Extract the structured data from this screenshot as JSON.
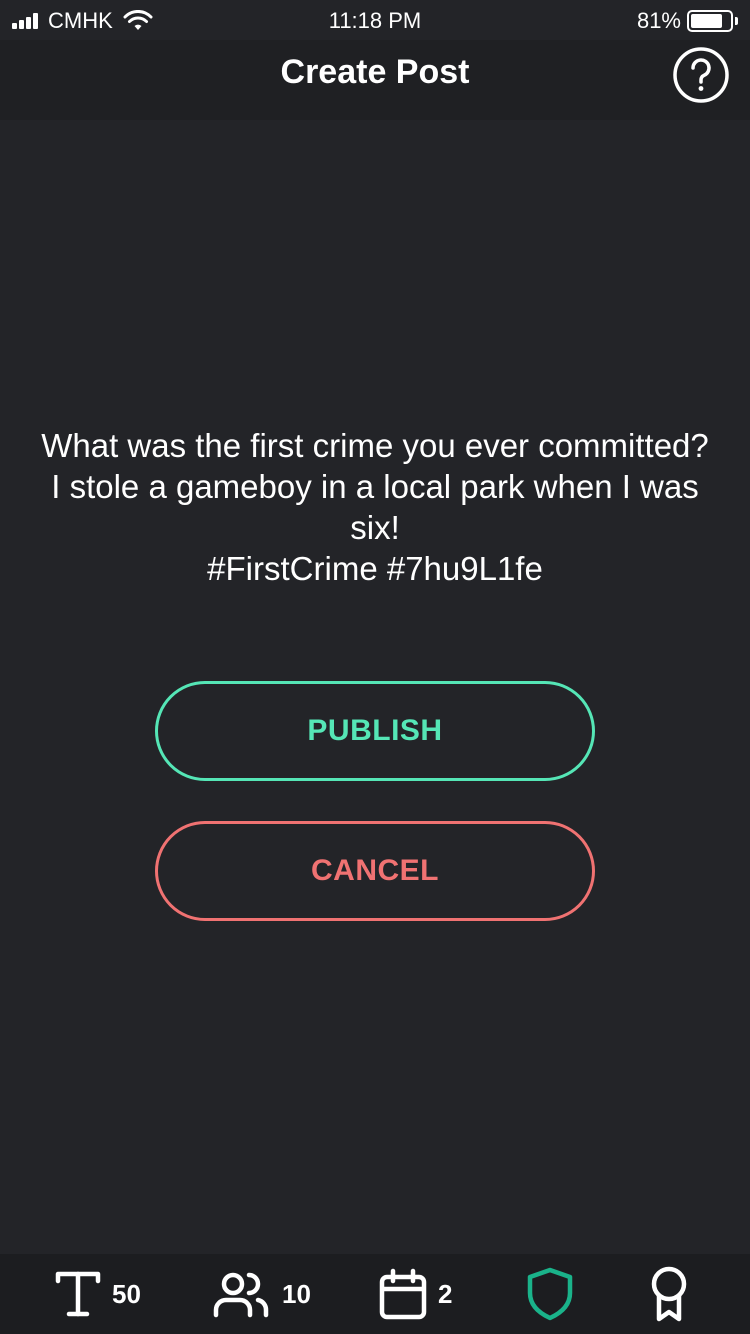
{
  "status_bar": {
    "carrier": "CMHK",
    "time": "11:18 PM",
    "battery_percent": "81%",
    "battery_level": 0.81,
    "signal_icon": "signal-bars-icon",
    "wifi_icon": "wifi-icon"
  },
  "header": {
    "title": "Create Post",
    "help_icon": "question-circle-icon"
  },
  "post": {
    "lines": [
      "What was the first crime you ever committed?",
      "I stole a gameboy in a local park when I was six!",
      "#FirstCrime #7hu9L1fe"
    ]
  },
  "actions": {
    "publish_label": "PUBLISH",
    "cancel_label": "CANCEL"
  },
  "tab_bar": {
    "text_count": "50",
    "people_count": "10",
    "calendar_count": "2",
    "icons": [
      "text-icon",
      "people-icon",
      "calendar-icon",
      "shield-icon",
      "award-ribbon-icon"
    ]
  },
  "colors": {
    "background": "#232428",
    "accent_green": "#55e6b6",
    "accent_red": "#f07272",
    "shield_active": "#1ab38a"
  }
}
